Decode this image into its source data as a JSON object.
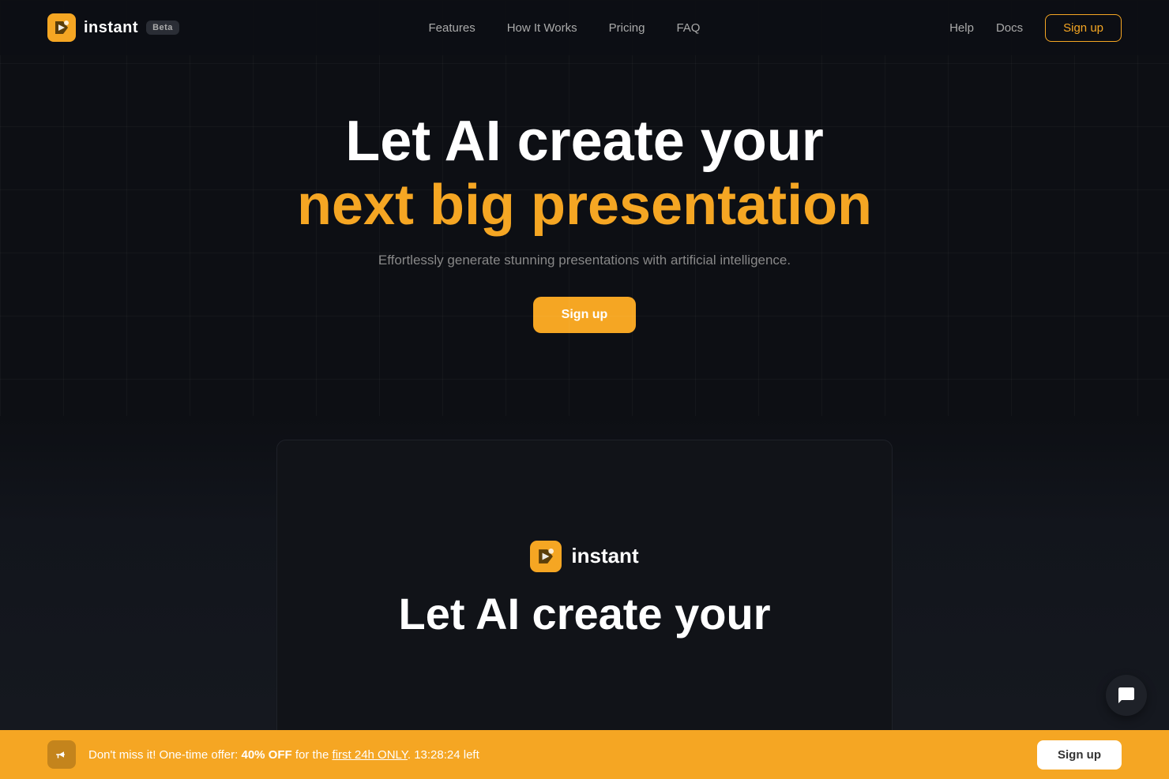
{
  "nav": {
    "logo_text": "instant",
    "beta_label": "Beta",
    "links": [
      {
        "id": "features",
        "label": "Features"
      },
      {
        "id": "how-it-works",
        "label": "How It Works"
      },
      {
        "id": "pricing",
        "label": "Pricing"
      },
      {
        "id": "faq",
        "label": "FAQ"
      }
    ],
    "right_links": [
      {
        "id": "help",
        "label": "Help"
      },
      {
        "id": "docs",
        "label": "Docs"
      }
    ],
    "signup_label": "Sign up"
  },
  "hero": {
    "title_line1": "Let AI create your",
    "title_line2": "next big presentation",
    "subtitle": "Effortlessly generate stunning presentations with artificial intelligence.",
    "cta_label": "Sign up"
  },
  "preview": {
    "logo_text": "instant",
    "headline": "Let AI create your"
  },
  "notification": {
    "text_before": "Don't miss it! One-time offer: ",
    "bold_text": "40% OFF",
    "text_middle": " for the ",
    "underline_text": "first 24h ONLY",
    "timer": "13:28:24 left",
    "signup_label": "Sign up"
  },
  "colors": {
    "accent": "#f5a623",
    "background": "#0d0f14",
    "nav_signup_border": "#f5a623"
  }
}
